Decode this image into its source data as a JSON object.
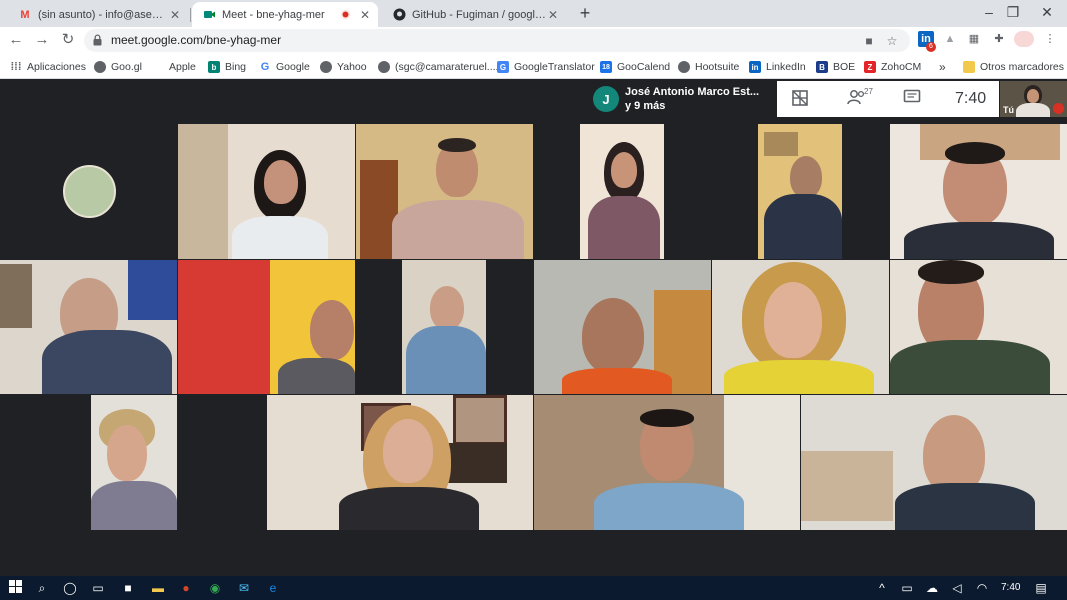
{
  "browser": {
    "tabs": [
      {
        "title": "(sin asunto) - info@asempaz.com",
        "favicon": "gmail-icon",
        "color": "#ea4335"
      },
      {
        "title": "Meet - bne-yhag-mer",
        "favicon": "meet-icon",
        "color": "#00897b",
        "recording_dot": true
      },
      {
        "title": "GitHub - Fugiman / google-meet",
        "favicon": "github-icon",
        "color": "#24292e"
      }
    ],
    "new_tab_glyph": "+",
    "window_controls": [
      "–",
      "❐",
      "✕"
    ],
    "url": "meet.google.com/bne-yhag-mer",
    "extension_badge": "6",
    "bookmarks": [
      {
        "label": "Aplicaciones",
        "icon": "apps-grid-icon",
        "color": "#5f6368"
      },
      {
        "label": "Goo.gl",
        "icon": "globe-icon",
        "color": "#5f6368"
      },
      {
        "label": "Apple",
        "icon": "apple-icon",
        "color": "#5f6368"
      },
      {
        "label": "Bing",
        "icon": "bing-icon",
        "color": "#008373"
      },
      {
        "label": "Google",
        "icon": "google-icon",
        "color": "#4285f4"
      },
      {
        "label": "Yahoo",
        "icon": "globe-icon",
        "color": "#5f6368"
      },
      {
        "label": "(sgc@camarateruel....",
        "icon": "globe-icon",
        "color": "#5f6368"
      },
      {
        "label": "GoogleTranslator",
        "icon": "translate-icon",
        "color": "#4285f4"
      },
      {
        "label": "GooCalend",
        "icon": "calendar-icon",
        "color": "#1a73e8"
      },
      {
        "label": "Hootsuite",
        "icon": "globe-icon",
        "color": "#5f6368"
      },
      {
        "label": "LinkedIn",
        "icon": "linkedin-icon",
        "color": "#0a66c2"
      },
      {
        "label": "BOE",
        "icon": "boe-icon",
        "color": "#1a3c8b"
      },
      {
        "label": "ZohoCM",
        "icon": "zoho-icon",
        "color": "#e42527"
      }
    ],
    "bookmarks_overflow": "»",
    "other_bookmarks": "Otros marcadores"
  },
  "meet": {
    "presenter": {
      "initial": "J",
      "line1": "José Antonio Marco Est...",
      "line2": "y 9 más"
    },
    "participant_count": "27",
    "clock": "7:40",
    "self_label": "Tú"
  },
  "taskbar": {
    "clock": "7:40"
  },
  "colors": {
    "meet_bg": "#202124",
    "tab_bar": "#dee1e6",
    "taskbar": "#0b1a2e",
    "presenter_avatar": "#12877a"
  }
}
